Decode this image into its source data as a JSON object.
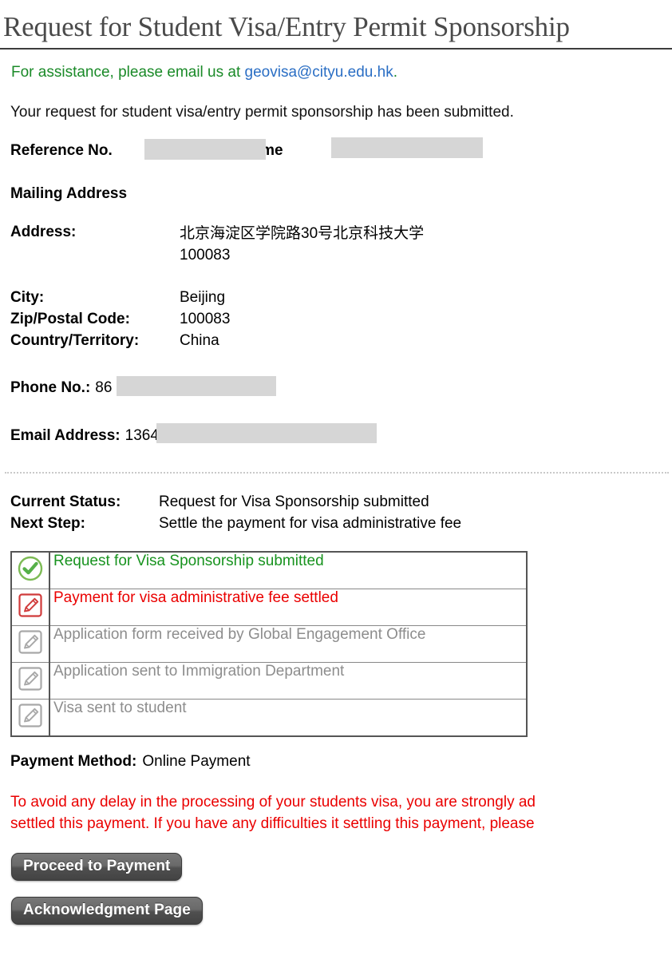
{
  "header": {
    "title": "Request for Student Visa/Entry Permit Sponsorship"
  },
  "assistance": {
    "prefix": "For assistance, please email us at ",
    "email": "geovisa@cityu.edu.hk",
    "suffix": "."
  },
  "confirmation": {
    "message": "Your request for student visa/entry permit sponsorship has been submitted."
  },
  "reference": {
    "ref_label": "Reference No.",
    "ref_value": "",
    "name_label": "Name",
    "name_value": ""
  },
  "mailing": {
    "section_title": "Mailing Address",
    "address_label": "Address:",
    "address_value": "北京海淀区学院路30号北京科技大学\n100083",
    "city_label": "City:",
    "city_value": "Beijing",
    "zip_label": "Zip/Postal Code:",
    "zip_value": "100083",
    "country_label": "Country/Territory:",
    "country_value": "China"
  },
  "contact": {
    "phone_label": "Phone No.:",
    "phone_value": "86 13641000001",
    "email_label": "Email Address:",
    "email_value": "13641000001@163.com"
  },
  "status": {
    "current_label": "Current Status:",
    "current_value": "Request for Visa Sponsorship submitted",
    "next_label": "Next Step:",
    "next_value": "Settle the payment for visa administrative fee"
  },
  "progress_steps": [
    {
      "label": "Request for Visa Sponsorship submitted",
      "state": "done",
      "icon": "check-circle-icon"
    },
    {
      "label": "Payment for visa administrative fee settled",
      "state": "current",
      "icon": "pencil-square-icon"
    },
    {
      "label": "Application form received by Global Engagement Office",
      "state": "pending",
      "icon": "pencil-square-icon"
    },
    {
      "label": "Application sent to Immigration Department",
      "state": "pending",
      "icon": "pencil-square-icon"
    },
    {
      "label": "Visa sent to student",
      "state": "pending",
      "icon": "pencil-square-icon"
    }
  ],
  "payment": {
    "method_label": "Payment Method:",
    "method_value": "Online Payment"
  },
  "warning": {
    "line1": "To avoid any delay in the processing of your students visa, you are strongly ad",
    "line2": "settled this payment. If you have any difficulties it settling this payment, please"
  },
  "buttons": {
    "proceed": "Proceed to Payment",
    "acknowledgment": "Acknowledgment Page"
  },
  "colors": {
    "green": "#18931f",
    "red": "#ea0000",
    "link_blue": "#2a6ec4",
    "pending_gray": "#8d8d8d",
    "title_gray": "#4a4a4a",
    "redaction_gray": "#d6d6d6"
  }
}
